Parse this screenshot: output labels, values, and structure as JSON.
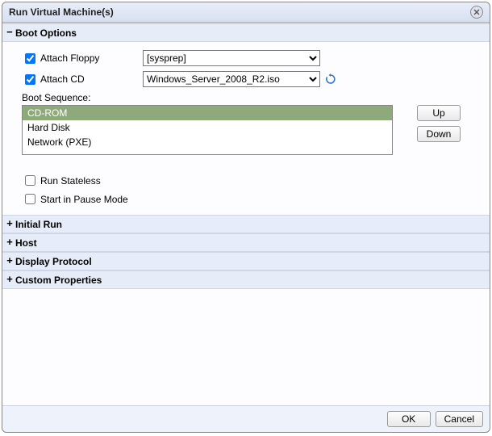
{
  "dialog": {
    "title": "Run Virtual Machine(s)"
  },
  "sections": {
    "boot_options": {
      "label": "Boot Options",
      "expanded": true
    },
    "initial_run": {
      "label": "Initial Run",
      "expanded": false
    },
    "host": {
      "label": "Host",
      "expanded": false
    },
    "display_protocol": {
      "label": "Display Protocol",
      "expanded": false
    },
    "custom_properties": {
      "label": "Custom Properties",
      "expanded": false
    }
  },
  "boot": {
    "attach_floppy": {
      "label": "Attach Floppy",
      "checked": true,
      "value": "[sysprep]"
    },
    "attach_cd": {
      "label": "Attach CD",
      "checked": true,
      "value": "Windows_Server_2008_R2.iso"
    },
    "boot_sequence_label": "Boot Sequence:",
    "boot_sequence": [
      "CD-ROM",
      "Hard Disk",
      "Network (PXE)"
    ],
    "boot_sequence_selected": 0,
    "run_stateless": {
      "label": "Run Stateless",
      "checked": false
    },
    "start_pause": {
      "label": "Start in Pause Mode",
      "checked": false
    }
  },
  "buttons": {
    "up": "Up",
    "down": "Down",
    "ok": "OK",
    "cancel": "Cancel"
  }
}
